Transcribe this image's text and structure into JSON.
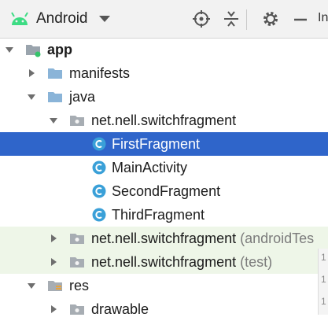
{
  "toolbar": {
    "title": "Android",
    "icons": [
      "android-icon",
      "locate-icon",
      "collapse-all-icon",
      "gear-icon",
      "minimize-icon"
    ],
    "cut_text": "In"
  },
  "tree": {
    "rows": [
      {
        "label": "app",
        "suffix": ""
      },
      {
        "label": "manifests",
        "suffix": ""
      },
      {
        "label": "java",
        "suffix": ""
      },
      {
        "label": "net.nell.switchfragment",
        "suffix": ""
      },
      {
        "label": "FirstFragment",
        "suffix": "",
        "selected": true
      },
      {
        "label": "MainActivity",
        "suffix": ""
      },
      {
        "label": "SecondFragment",
        "suffix": ""
      },
      {
        "label": "ThirdFragment",
        "suffix": ""
      },
      {
        "label": "net.nell.switchfragment",
        "suffix": " (androidTes"
      },
      {
        "label": "net.nell.switchfragment",
        "suffix": " (test)"
      },
      {
        "label": "res",
        "suffix": ""
      },
      {
        "label": "drawable",
        "suffix": ""
      }
    ]
  },
  "gutter": {
    "line_numbers": [
      "1",
      "1",
      "1"
    ]
  },
  "colors": {
    "selection": "#2f65ca",
    "folder": "#8ab4d8",
    "class_icon": "#3aa0d8",
    "android_green": "#3ddc84"
  }
}
